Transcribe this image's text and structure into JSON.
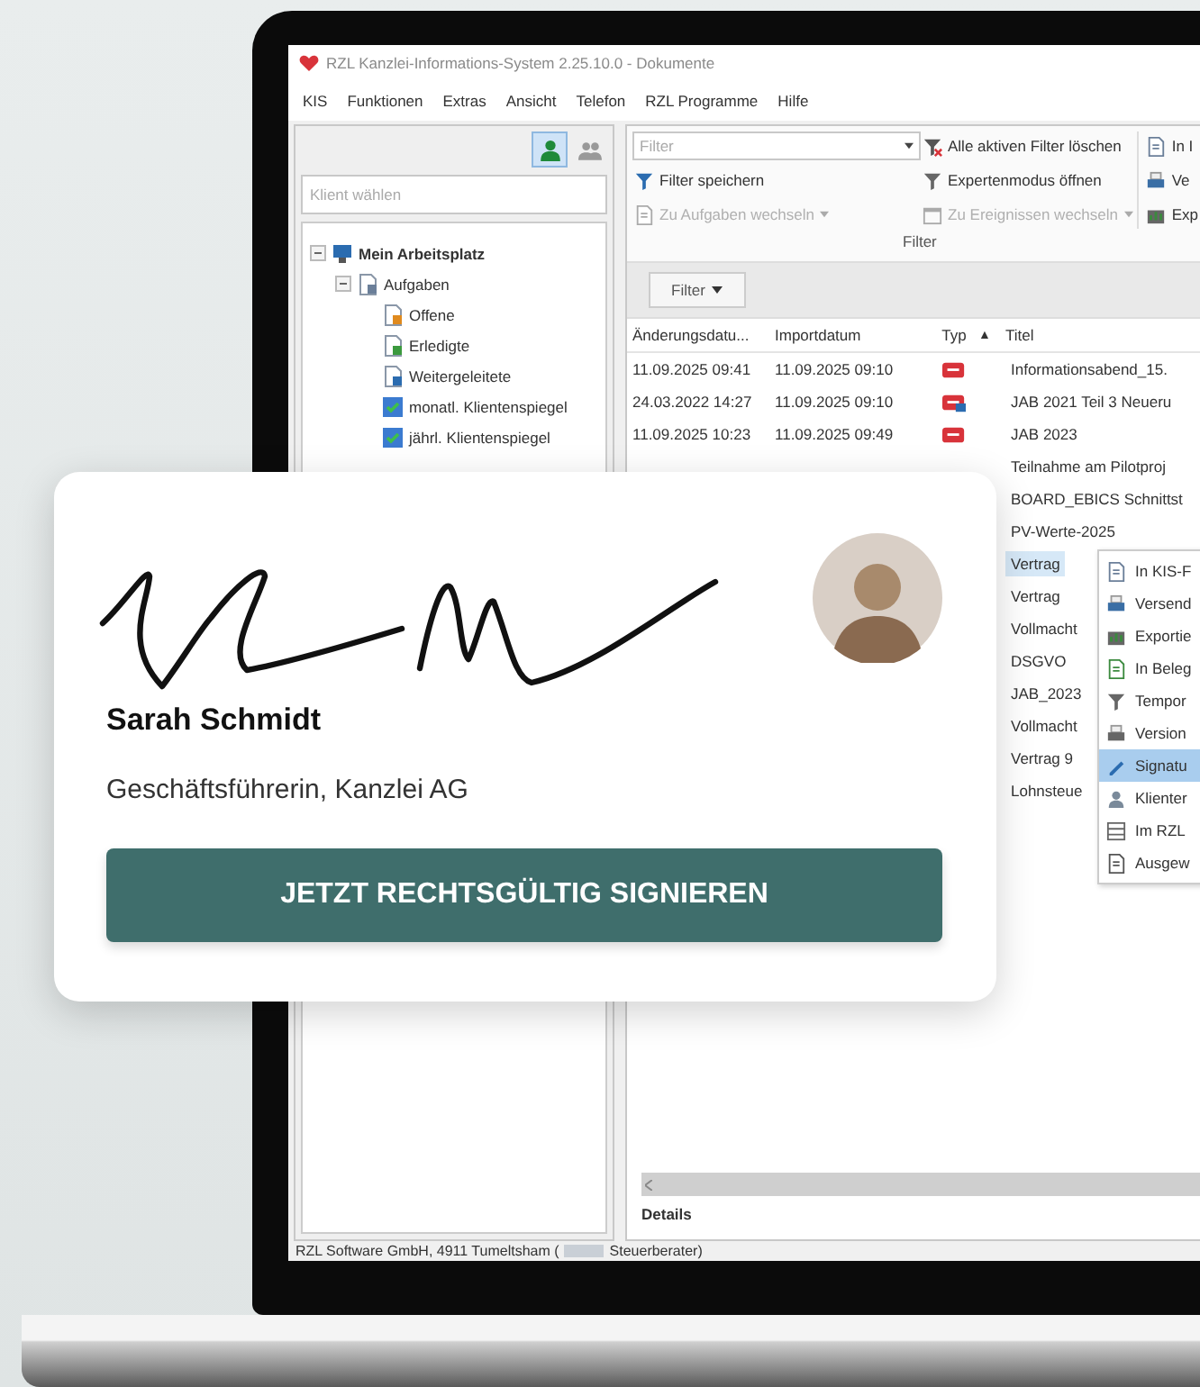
{
  "window": {
    "title": "RZL Kanzlei-Informations-System 2.25.10.0 - Dokumente"
  },
  "menu": [
    "KIS",
    "Funktionen",
    "Extras",
    "Ansicht",
    "Telefon",
    "RZL Programme",
    "Hilfe"
  ],
  "client_pane": {
    "view_toggles": [
      {
        "kind": "person",
        "selected": true
      },
      {
        "kind": "group",
        "selected": false
      }
    ],
    "search": {
      "placeholder": "Klient wählen"
    },
    "tree": [
      {
        "label": "Mein Arbeitsplatz",
        "kind": "workplace",
        "expanded": true,
        "children": [
          {
            "label": "Aufgaben",
            "kind": "task-list",
            "expanded": true,
            "children": [
              {
                "label": "Offene",
                "kind": "open"
              },
              {
                "label": "Erledigte",
                "kind": "done"
              },
              {
                "label": "Weitergeleitete",
                "kind": "forwarded"
              },
              {
                "label": "monatl. Klientenspiegel",
                "kind": "report"
              },
              {
                "label": "jährl. Klientenspiegel",
                "kind": "report"
              }
            ]
          }
        ]
      }
    ]
  },
  "ribbon": {
    "items": [
      {
        "kind": "combo",
        "placeholder": "Filter"
      },
      {
        "kind": "save-filter",
        "label": "Filter speichern",
        "disabled": false
      },
      {
        "kind": "tasks",
        "label": "Zu Aufgaben wechseln",
        "disabled": true,
        "dropdown": true
      },
      {
        "kind": "clear-filter",
        "label": "Alle aktiven Filter löschen",
        "disabled": false
      },
      {
        "kind": "expert",
        "label": "Expertenmodus öffnen",
        "disabled": false
      },
      {
        "kind": "events",
        "label": "Zu Ereignissen wechseln",
        "disabled": true,
        "dropdown": true
      },
      {
        "kind": "page",
        "label": "In I",
        "disabled": false
      },
      {
        "kind": "send",
        "label": "Ve",
        "disabled": false
      },
      {
        "kind": "export",
        "label": "Exp",
        "disabled": false
      }
    ],
    "group_label": "Filter"
  },
  "filter_button": {
    "label": "Filter"
  },
  "table": {
    "columns": [
      {
        "label": "Änderungsdatu..."
      },
      {
        "label": "Importdatum"
      },
      {
        "label": "Typ",
        "sort_mark": "▲"
      },
      {
        "label": "Titel"
      }
    ],
    "rows": [
      {
        "changed": "11.09.2025 09:41",
        "imported": "11.09.2025 09:10",
        "kind": "pdf",
        "title": "Informationsabend_15.",
        "selected": false
      },
      {
        "changed": "24.03.2022 14:27",
        "imported": "11.09.2025 09:10",
        "kind": "pdf-linked",
        "title": "JAB 2021 Teil 3 Neueru",
        "selected": false
      },
      {
        "changed": "11.09.2025 10:23",
        "imported": "11.09.2025 09:49",
        "kind": "pdf",
        "title": "JAB 2023",
        "selected": false
      },
      {
        "title": "Teilnahme am Pilotproj",
        "selected": false
      },
      {
        "title": "BOARD_EBICS Schnittst",
        "selected": false
      },
      {
        "title": "PV-Werte-2025",
        "selected": false
      },
      {
        "title": "Vertrag",
        "selected": true
      },
      {
        "title": "Vertrag",
        "selected": false
      },
      {
        "title": "Vollmacht",
        "selected": false
      },
      {
        "title": "DSGVO",
        "selected": false
      },
      {
        "title": "JAB_2023",
        "selected": false
      },
      {
        "title": "Vollmacht",
        "selected": false
      },
      {
        "title": "Vertrag 9",
        "selected": false
      },
      {
        "title": "Lohnsteue",
        "selected": false
      }
    ]
  },
  "context_menu": [
    {
      "kind": "copy",
      "label": "In KIS-F",
      "selected": false
    },
    {
      "kind": "send",
      "label": "Versend",
      "selected": false
    },
    {
      "kind": "export",
      "label": "Exportie",
      "selected": false
    },
    {
      "kind": "document",
      "label": "In Beleg",
      "selected": false
    },
    {
      "kind": "temp",
      "label": "Tempor",
      "selected": false
    },
    {
      "kind": "versions",
      "label": "Version",
      "selected": false
    },
    {
      "kind": "sign",
      "label": "Signatu",
      "selected": true
    },
    {
      "kind": "client",
      "label": "Klienter",
      "selected": false
    },
    {
      "kind": "rzl",
      "label": "Im RZL",
      "selected": false
    },
    {
      "kind": "selected",
      "label": "Ausgew",
      "selected": false
    }
  ],
  "details": {
    "label": "Details"
  },
  "status_bar": {
    "left": "RZL Software GmbH, 4911 Tumeltsham (",
    "right": "Steuerberater)"
  },
  "card": {
    "name": "Sarah Schmidt",
    "role": "Geschäftsführerin, Kanzlei AG",
    "button": "JETZT RECHTSGÜLTIG SIGNIEREN"
  }
}
